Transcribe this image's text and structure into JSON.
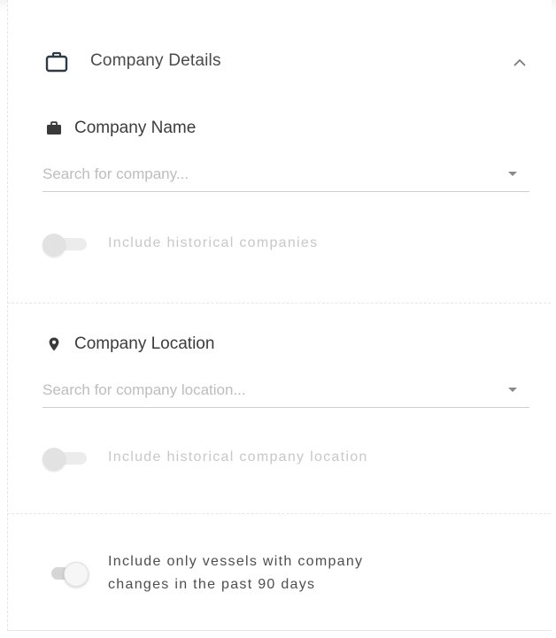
{
  "section": {
    "title": "Company Details",
    "collapse_icon": "chevron-up-icon",
    "header_icon": "briefcase-outline-icon"
  },
  "company_name": {
    "label": "Company Name",
    "icon": "briefcase-icon",
    "search_placeholder": "Search for company...",
    "search_value": "",
    "historical_toggle": {
      "label": "Include historical companies",
      "checked": false,
      "disabled": true
    }
  },
  "company_location": {
    "label": "Company Location",
    "icon": "location-pin-icon",
    "search_placeholder": "Search for company location...",
    "search_value": "",
    "historical_toggle": {
      "label": "Include historical company location",
      "checked": false,
      "disabled": true
    }
  },
  "recent_changes": {
    "line1": "Include only vessels with company",
    "line2": "changes in the past 90 days",
    "checked": false
  },
  "colors": {
    "text": "#3c3c3c",
    "placeholder": "#bdbdbd",
    "disabled_text": "#c8c8c8",
    "icon": "#3a3a3a"
  }
}
